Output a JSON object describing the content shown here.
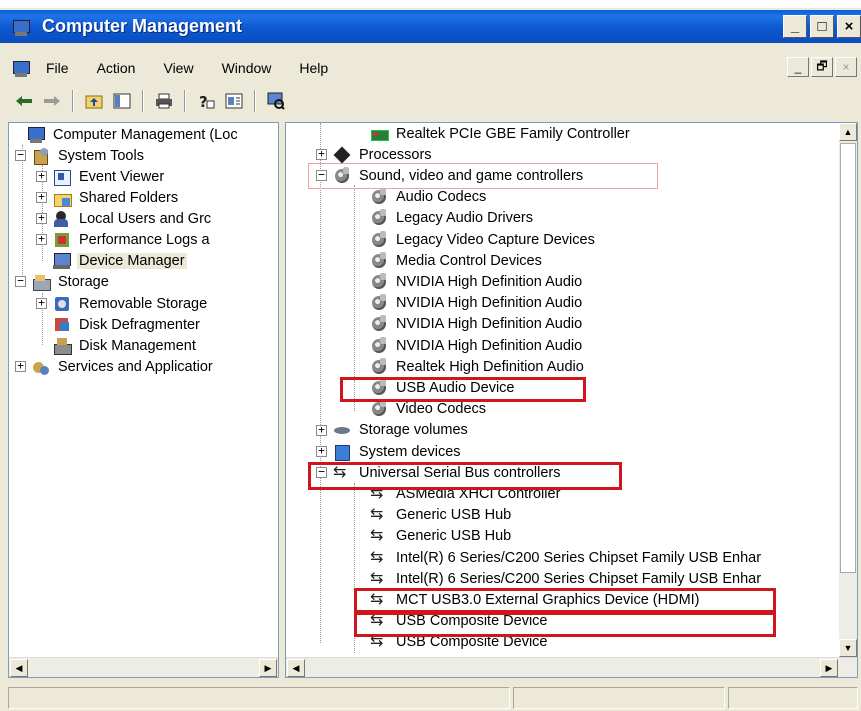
{
  "window": {
    "title": "Computer Management",
    "caption_buttons": [
      "_",
      "□",
      "×"
    ]
  },
  "menu": {
    "items": [
      "File",
      "Action",
      "View",
      "Window",
      "Help"
    ],
    "mdi_buttons": [
      "_",
      "🗗",
      "×"
    ]
  },
  "toolbar": {
    "buttons": [
      "back-icon",
      "forward-icon",
      "up-folder-icon",
      "show-hide-tree-icon",
      "print-icon",
      "help-icon",
      "properties-icon",
      "scan-hardware-icon"
    ]
  },
  "left_tree": {
    "items": [
      {
        "label": "Computer Management (Loc",
        "icon": "computer-icon",
        "level": 0
      },
      {
        "label": "System Tools",
        "icon": "tools-icon",
        "level": 1,
        "expander": "−"
      },
      {
        "label": "Event Viewer",
        "icon": "event-viewer-icon",
        "level": 2,
        "expander": "+"
      },
      {
        "label": "Shared Folders",
        "icon": "shared-folders-icon",
        "level": 2,
        "expander": "+"
      },
      {
        "label": "Local Users and Grc",
        "icon": "users-icon",
        "level": 2,
        "expander": "+"
      },
      {
        "label": "Performance Logs a",
        "icon": "performance-icon",
        "level": 2,
        "expander": "+"
      },
      {
        "label": "Device Manager",
        "icon": "device-manager-icon",
        "level": 2,
        "expander": ""
      },
      {
        "label": "Storage",
        "icon": "storage-icon",
        "level": 1,
        "expander": "−"
      },
      {
        "label": "Removable Storage",
        "icon": "removable-storage-icon",
        "level": 2,
        "expander": "+"
      },
      {
        "label": "Disk Defragmenter",
        "icon": "defrag-icon",
        "level": 2,
        "expander": ""
      },
      {
        "label": "Disk Management",
        "icon": "disk-management-icon",
        "level": 2,
        "expander": ""
      },
      {
        "label": "Services and Applicatior",
        "icon": "services-icon",
        "level": 1,
        "expander": "+"
      }
    ]
  },
  "right_tree": {
    "items": [
      {
        "label": "Realtek PCIe GBE Family Controller",
        "icon": "network-adapter-icon",
        "level": 2
      },
      {
        "label": "Processors",
        "icon": "processor-icon",
        "level": 1,
        "expander": "+"
      },
      {
        "label": "Sound, video and game controllers",
        "icon": "sound-icon",
        "level": 1,
        "expander": "−"
      },
      {
        "label": "Audio Codecs",
        "icon": "sound-icon",
        "level": 2
      },
      {
        "label": "Legacy Audio Drivers",
        "icon": "sound-icon",
        "level": 2
      },
      {
        "label": "Legacy Video Capture Devices",
        "icon": "sound-icon",
        "level": 2
      },
      {
        "label": "Media Control Devices",
        "icon": "sound-icon",
        "level": 2
      },
      {
        "label": "NVIDIA High Definition Audio",
        "icon": "sound-icon",
        "level": 2
      },
      {
        "label": "NVIDIA High Definition Audio",
        "icon": "sound-icon",
        "level": 2
      },
      {
        "label": "NVIDIA High Definition Audio",
        "icon": "sound-icon",
        "level": 2
      },
      {
        "label": "NVIDIA High Definition Audio",
        "icon": "sound-icon",
        "level": 2
      },
      {
        "label": "Realtek High Definition Audio",
        "icon": "sound-icon",
        "level": 2
      },
      {
        "label": "USB Audio Device",
        "icon": "sound-icon",
        "level": 2
      },
      {
        "label": "Video Codecs",
        "icon": "sound-icon",
        "level": 2
      },
      {
        "label": "Storage volumes",
        "icon": "storage-volume-icon",
        "level": 1,
        "expander": "+"
      },
      {
        "label": "System devices",
        "icon": "system-devices-icon",
        "level": 1,
        "expander": "+"
      },
      {
        "label": "Universal Serial Bus controllers",
        "icon": "usb-icon",
        "level": 1,
        "expander": "−"
      },
      {
        "label": "ASMedia XHCI Controller",
        "icon": "usb-icon",
        "level": 2
      },
      {
        "label": "Generic USB Hub",
        "icon": "usb-icon",
        "level": 2
      },
      {
        "label": "Generic USB Hub",
        "icon": "usb-icon",
        "level": 2
      },
      {
        "label": "Intel(R) 6 Series/C200 Series Chipset Family USB Enhar",
        "icon": "usb-icon",
        "level": 2
      },
      {
        "label": "Intel(R) 6 Series/C200 Series Chipset Family USB Enhar",
        "icon": "usb-icon",
        "level": 2
      },
      {
        "label": "MCT USB3.0 External Graphics Device (HDMI)",
        "icon": "usb-icon",
        "level": 2
      },
      {
        "label": "USB Composite Device",
        "icon": "usb-icon",
        "level": 2
      },
      {
        "label": "USB Composite Device",
        "icon": "usb-icon",
        "level": 2
      }
    ]
  },
  "colors": {
    "titlebar": "#0a58cf",
    "highlight": "#d0151c",
    "window_bg": "#ece9d8"
  }
}
